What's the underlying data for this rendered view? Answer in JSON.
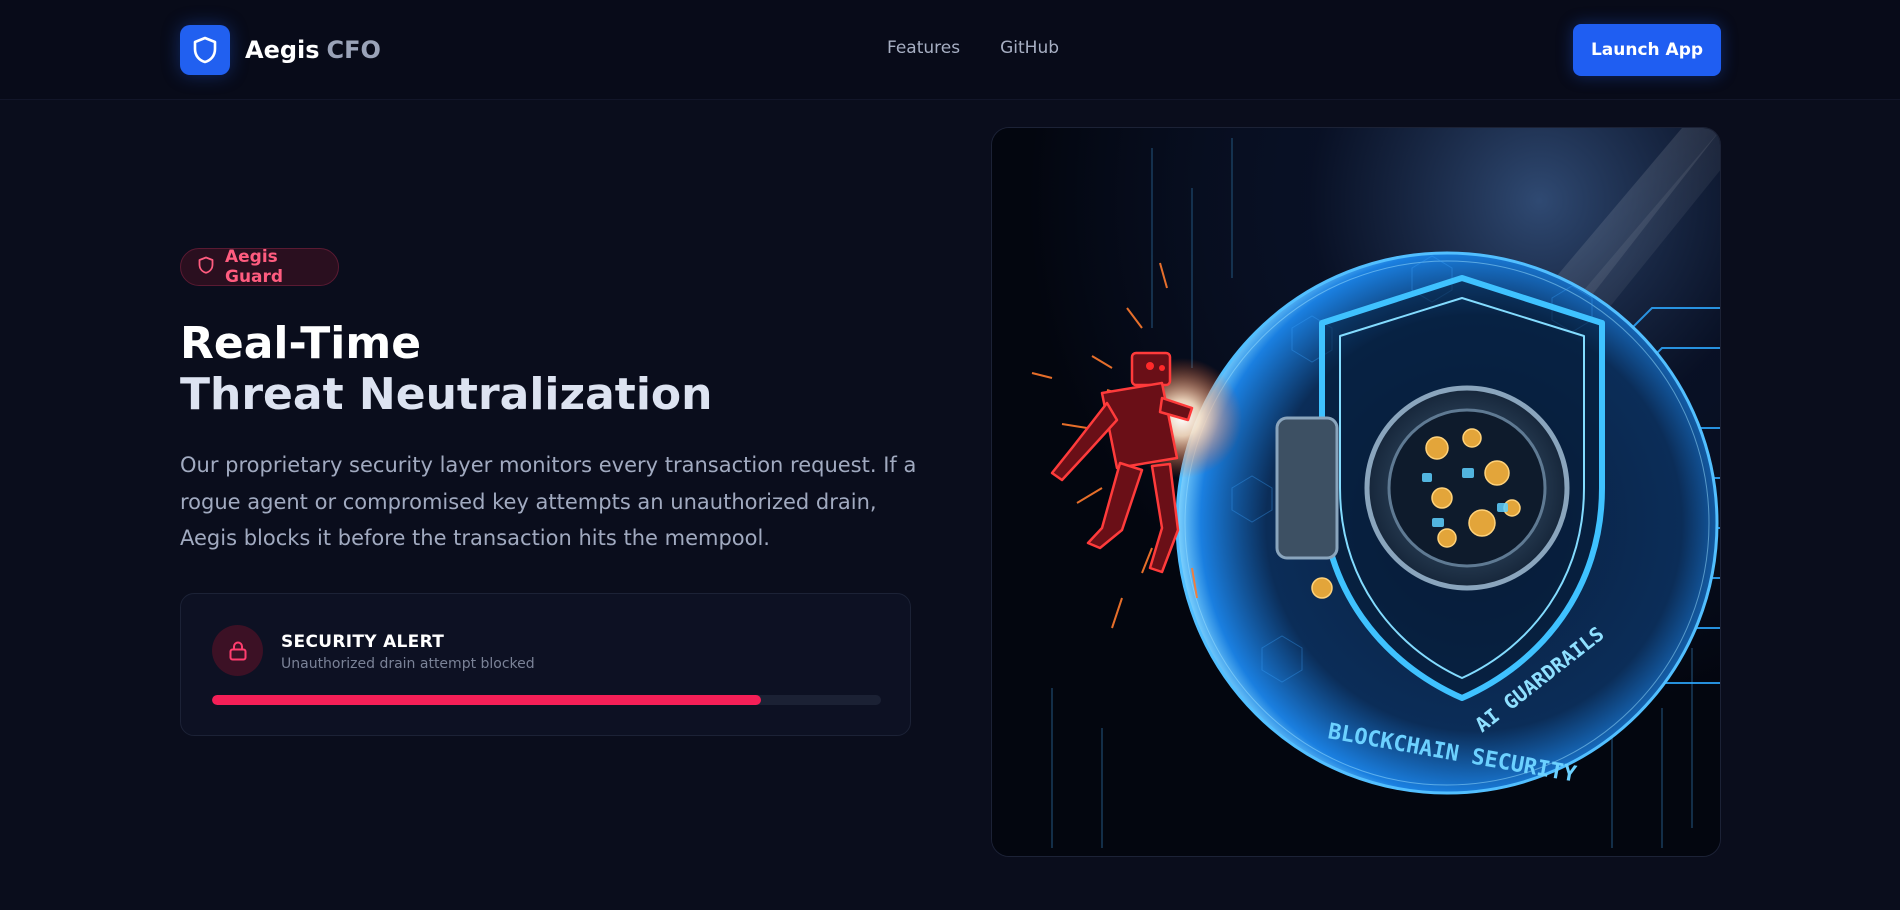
{
  "nav": {
    "brand_name": "Aegis",
    "brand_suffix": "CFO",
    "brand_icon": "shield-icon",
    "links": [
      {
        "label": "Features"
      },
      {
        "label": "GitHub"
      }
    ],
    "cta_label": "Launch App"
  },
  "hero": {
    "badge_label": "Aegis Guard",
    "badge_icon": "shield-icon",
    "headline_line1": "Real-Time",
    "headline_line2": "Threat Neutralization",
    "description": "Our proprietary security layer monitors every transaction request. If a rogue agent or compromised key attempts an unauthorized drain, Aegis blocks it before the transaction hits the mempool."
  },
  "alert": {
    "icon": "lock-icon",
    "title": "SECURITY ALERT",
    "subtitle": "Unauthorized drain attempt blocked",
    "progress_percent": 82
  },
  "illustration": {
    "caption_1": "AI GUARDRAILS",
    "caption_2": "BLOCKCHAIN SECURITY"
  },
  "colors": {
    "accent_blue": "#1f5ef2",
    "alert_red": "#f41f57",
    "background": "#0a0d1c"
  }
}
